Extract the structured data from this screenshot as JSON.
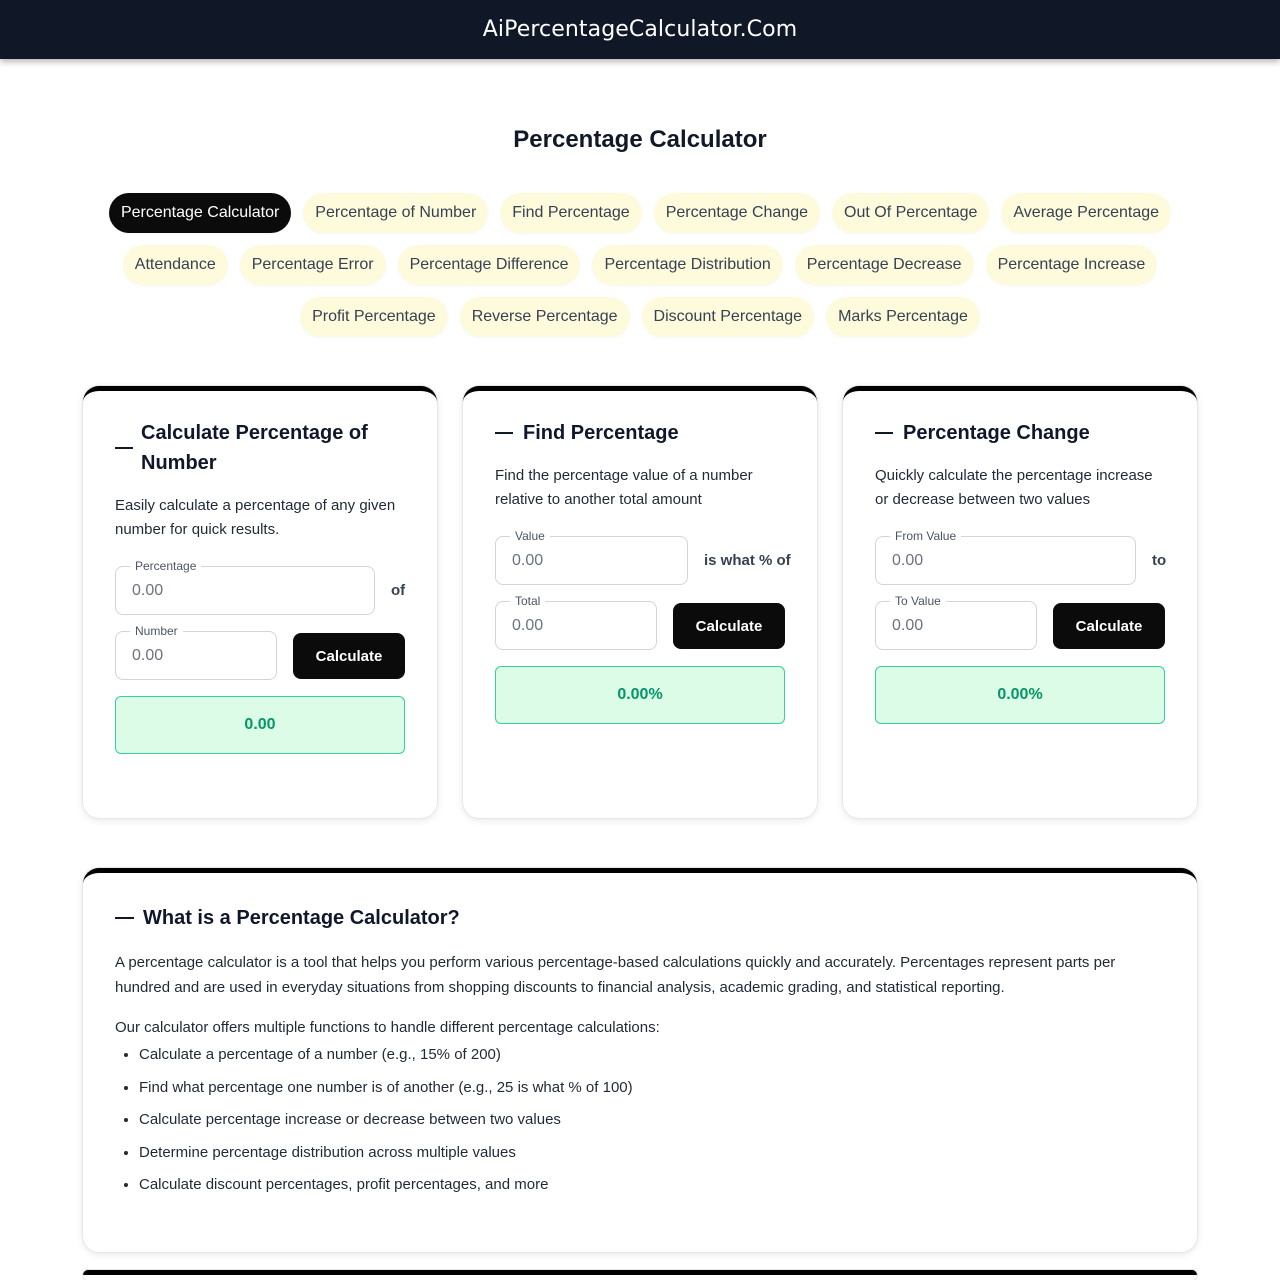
{
  "header": {
    "brand": "AiPercentageCalculator.Com"
  },
  "page": {
    "title": "Percentage Calculator"
  },
  "nav": {
    "row1": [
      "Percentage Calculator",
      "Percentage of Number",
      "Find Percentage",
      "Percentage Change",
      "Out Of Percentage",
      "Average Percentage"
    ],
    "row2": [
      "Attendance",
      "Percentage Error",
      "Percentage Difference",
      "Percentage Distribution",
      "Percentage Decrease",
      "Percentage Increase"
    ],
    "row3": [
      "Profit Percentage",
      "Reverse Percentage",
      "Discount Percentage",
      "Marks Percentage"
    ],
    "active": "Percentage Calculator"
  },
  "cards": {
    "percentage_of_number": {
      "title": "Calculate Percentage of Number",
      "description": "Easily calculate a percentage of any given number for quick results.",
      "percentage_label": "Percentage",
      "percentage_placeholder": "0.00",
      "connector": "of",
      "number_label": "Number",
      "number_placeholder": "0.00",
      "button": "Calculate",
      "result": "0.00"
    },
    "find_percentage": {
      "title": "Find Percentage",
      "description": "Find the percentage value of a number relative to another total amount",
      "value_label": "Value",
      "value_placeholder": "0.00",
      "connector": "is what % of",
      "total_label": "Total",
      "total_placeholder": "0.00",
      "button": "Calculate",
      "result": "0.00%"
    },
    "percentage_change": {
      "title": "Percentage Change",
      "description": "Quickly calculate the percentage increase or decrease between two values",
      "from_label": "From Value",
      "from_placeholder": "0.00",
      "connector": "to",
      "to_label": "To Value",
      "to_placeholder": "0.00",
      "button": "Calculate",
      "result": "0.00%"
    }
  },
  "info": {
    "title": "What is a Percentage Calculator?",
    "paragraph1": "A percentage calculator is a tool that helps you perform various percentage-based calculations quickly and accurately. Percentages represent parts per hundred and are used in everyday situations from shopping discounts to financial analysis, academic grading, and statistical reporting.",
    "paragraph2": "Our calculator offers multiple functions to handle different percentage calculations:",
    "list": [
      "Calculate a percentage of a number (e.g., 15% of 200)",
      "Find what percentage one number is of another (e.g., 25 is what % of 100)",
      "Calculate percentage increase or decrease between two values",
      "Determine percentage distribution across multiple values",
      "Calculate discount percentages, profit percentages, and more"
    ]
  },
  "colors": {
    "header_bg": "#101828",
    "pill_bg": "#fefbdc",
    "pill_active_bg": "#0b0b0b",
    "button_bg": "#0b0b0b",
    "result_bg": "#dcfce7",
    "result_border": "#34d399",
    "result_text": "#059669"
  }
}
